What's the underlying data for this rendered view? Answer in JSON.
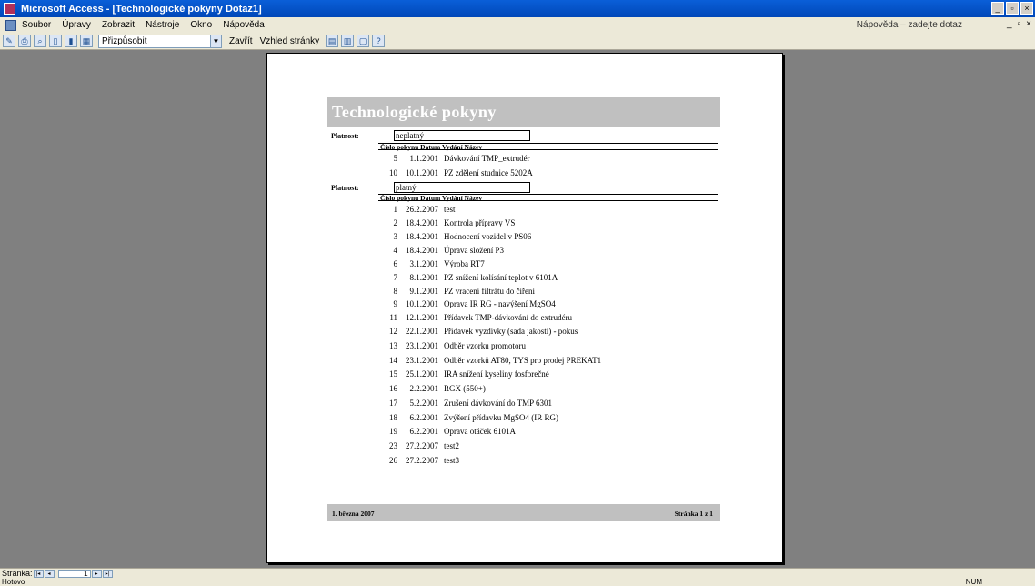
{
  "window": {
    "title": "Microsoft Access - [Technologické pokyny Dotaz1]",
    "controls": {
      "minimize": "_",
      "restore": "▫",
      "close": "×"
    }
  },
  "menubar": {
    "items": [
      "Soubor",
      "Úpravy",
      "Zobrazit",
      "Nástroje",
      "Okno",
      "Nápověda"
    ],
    "help_placeholder": "Nápověda – zadejte dotaz",
    "mdi_controls": {
      "minimize": "_",
      "restore": "▫",
      "close": "×"
    }
  },
  "toolbar": {
    "zoom_value": "Přizpůsobit",
    "close_label": "Zavřít",
    "setup_label": "Vzhled stránky"
  },
  "report": {
    "title": "Technologické pokyny",
    "groups": [
      {
        "status_label": "Platnost:",
        "status_value": "neplatný",
        "header": "Číslo pokynu    Datum Vydání  Název",
        "rows": [
          {
            "num": "5",
            "date": "1.1.2001",
            "name": "Dávkování TMP_extrudér"
          },
          {
            "num": "10",
            "date": "10.1.2001",
            "name": "PZ zdělení studnice 5202A"
          }
        ]
      },
      {
        "status_label": "Platnost:",
        "status_value": "platný",
        "header": "Číslo pokynu    Datum Vydání  Název",
        "rows": [
          {
            "num": "1",
            "date": "26.2.2007",
            "name": "test"
          },
          {
            "num": "2",
            "date": "18.4.2001",
            "name": "Kontrola přípravy VS"
          },
          {
            "num": "3",
            "date": "18.4.2001",
            "name": "Hodnocení vozidel v PS06"
          },
          {
            "num": "4",
            "date": "18.4.2001",
            "name": "Úprava složení P3"
          },
          {
            "num": "6",
            "date": "3.1.2001",
            "name": "Výroba RT7"
          },
          {
            "num": "7",
            "date": "8.1.2001",
            "name": "PZ snížení kolísání teplot v 6101A"
          },
          {
            "num": "8",
            "date": "9.1.2001",
            "name": "PZ vracení filtrátu do čiření"
          },
          {
            "num": "9",
            "date": "10.1.2001",
            "name": "Oprava IR RG - navýšení MgSO4"
          },
          {
            "num": "11",
            "date": "12.1.2001",
            "name": "Přídavek TMP-dávkování do extrudéru"
          },
          {
            "num": "12",
            "date": "22.1.2001",
            "name": "Přídavek vyzdívky (sada jakosti) - pokus"
          },
          {
            "num": "13",
            "date": "23.1.2001",
            "name": "Odběr vzorku promotoru"
          },
          {
            "num": "14",
            "date": "23.1.2001",
            "name": "Odběr vzorků AT80, TYS pro prodej PREKAT1"
          },
          {
            "num": "15",
            "date": "25.1.2001",
            "name": "IRA snížení kyseliny fosforečné"
          },
          {
            "num": "16",
            "date": "2.2.2001",
            "name": "RGX (550+)"
          },
          {
            "num": "17",
            "date": "5.2.2001",
            "name": "Zrušení dávkování do TMP 6301"
          },
          {
            "num": "18",
            "date": "6.2.2001",
            "name": "Zvýšení přídavku MgSO4 (IR RG)"
          },
          {
            "num": "19",
            "date": "6.2.2001",
            "name": "Oprava otáček 6101A"
          },
          {
            "num": "23",
            "date": "27.2.2007",
            "name": "test2"
          },
          {
            "num": "26",
            "date": "27.2.2007",
            "name": "test3"
          }
        ]
      }
    ],
    "footer_date": "1. března 2007",
    "footer_page": "Stránka 1 z 1"
  },
  "navigation": {
    "label": "Stránka:",
    "page_value": "1",
    "buttons": {
      "first": "|◂",
      "prev": "◂",
      "next": "▸",
      "last": "▸|"
    }
  },
  "statusbar": {
    "text": "Hotovo",
    "num_indicator": "NUM"
  }
}
